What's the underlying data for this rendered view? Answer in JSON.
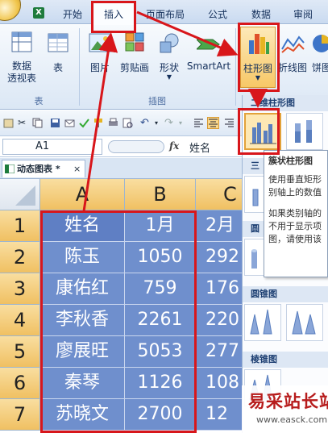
{
  "tabs": [
    "开始",
    "插入",
    "页面布局",
    "公式",
    "数据",
    "审阅"
  ],
  "app_icon": "X",
  "ribbon": {
    "pivot": "数据\n透视表",
    "table": "表",
    "picture": "图片",
    "clipart": "剪贴画",
    "shapes": "形状",
    "smartart": "SmartArt",
    "column_chart": "柱形图",
    "line_chart": "折线图",
    "pie_chart": "饼图",
    "group_tables": "表",
    "group_illustrations": "插图"
  },
  "formula_bar": {
    "name_box": "A1",
    "fx": "fx",
    "value": "姓名"
  },
  "sheet_tab": "动态图表 *",
  "grid": {
    "col_headers": [
      "A",
      "B",
      "C"
    ],
    "row_headers": [
      "1",
      "2",
      "3",
      "4",
      "5",
      "6",
      "7"
    ],
    "rows": [
      [
        "姓名",
        "1月",
        "2月"
      ],
      [
        "陈玉",
        "1050",
        "292"
      ],
      [
        "康佑红",
        "759",
        "176"
      ],
      [
        "李秋香",
        "2261",
        "220"
      ],
      [
        "廖展旺",
        "5053",
        "277"
      ],
      [
        "秦琴",
        "1126",
        "108"
      ],
      [
        "苏晓文",
        "2700",
        "12"
      ]
    ]
  },
  "dropdown": {
    "section_2d": "二维柱形图",
    "section_3d": "三",
    "section_cylinder": "圆",
    "section_cone": "圆锥图",
    "section_pyramid": "棱锥图"
  },
  "tooltip": {
    "title": "簇状柱形图",
    "line1": "使用垂直矩形",
    "line2": "别轴上的数值",
    "line3": "如果类别轴的",
    "line4": "不用于显示项",
    "line5": "图，请使用该"
  },
  "watermark": {
    "cn": "易采站长站",
    "url": "www.easck.com"
  },
  "colors": {
    "selection": "#6f8fcd",
    "callout": "#d8161b",
    "accent": "#e2a23a"
  }
}
